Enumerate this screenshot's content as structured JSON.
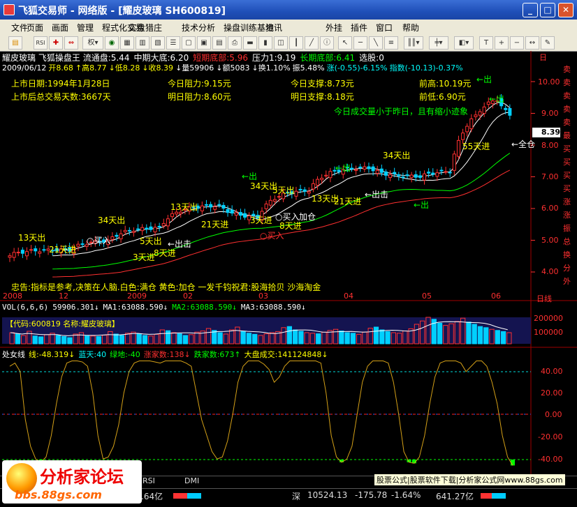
{
  "window": {
    "title": "飞狐交易师 - 网络版 - [耀皮玻璃  SH600819]",
    "controls": [
      "_",
      "□",
      "✕"
    ]
  },
  "menu": [
    "文件",
    "页面",
    "画面",
    "管理",
    "程式化交易",
    "实盘猎庄",
    "技术分析",
    "操盘训练基地",
    "资讯",
    "外挂",
    "插件",
    "窗口",
    "帮助"
  ],
  "toolbar": {
    "quanlabel": "权",
    "items": [
      "open-icon",
      "rsi-icon",
      "cross-icon",
      "arrows-icon",
      "weight-dropdown",
      "chart-icon",
      "grid-icon",
      "bars-icon",
      "period-icon",
      "zoom-icon"
    ]
  },
  "stock": {
    "name": "耀皮玻璃",
    "system": "飞狐操盘王",
    "line1": [
      {
        "t": "流通盘:5.44",
        "c": "#ffffff"
      },
      {
        "t": "中期大底:6.20",
        "c": "#ffffff"
      },
      {
        "t": "短期底部:5.96",
        "c": "#ff3030"
      },
      {
        "t": "压力1:9.19",
        "c": "#ffffff"
      },
      {
        "t": "长期底部:6.41",
        "c": "#00ff00"
      },
      {
        "t": "选股:0",
        "c": "#ffffff"
      }
    ],
    "line2": [
      {
        "t": "2009/06/12",
        "c": "#ffffff"
      },
      {
        "t": "开8.68",
        "c": "#ffff00"
      },
      {
        "t": "↑高8.77",
        "c": "#ffff00"
      },
      {
        "t": "↓低8.28",
        "c": "#ffff00"
      },
      {
        "t": "↓收8.39",
        "c": "#ffff00"
      },
      {
        "t": "↓量59906",
        "c": "#ffffff"
      },
      {
        "t": "↓额5083",
        "c": "#ffffff"
      },
      {
        "t": "↓换1.10%",
        "c": "#ffffff"
      },
      {
        "t": "振5.48%",
        "c": "#ffffff"
      },
      {
        "t": "涨(-0.55)-6.15%",
        "c": "#00ffff"
      },
      {
        "t": "指数(-10.13)-0.37%",
        "c": "#00ffff"
      }
    ]
  },
  "info": {
    "list_date_label": "上市日期:",
    "list_date": "1994年1月28日",
    "days_label": "上市后总交易天数:",
    "days": "3667天",
    "res_today": "今日阻力:9.15元",
    "res_tomorrow": "明日阻力:8.60元",
    "sup_today": "今日支撑:8.73元",
    "sup_tomorrow": "明日支撑:8.18元",
    "prev_high": "前高:10.19元",
    "prev_low": "前低:6.90元",
    "volume_note": "今日成交量小于昨日，且有缩小迹象",
    "footer": "忠告:指标是参考,决策在人脑.白色:满仓   黄色:加仓   一发千钧祝君:股海拾贝 沙海淘金"
  },
  "annotations": [
    {
      "t": "13天出",
      "c": "#ffff00"
    },
    {
      "t": "21天进",
      "c": "#ffff00"
    },
    {
      "t": "34天出",
      "c": "#ffff00"
    },
    {
      "t": "○买入",
      "c": "#ffffff"
    },
    {
      "t": "5天出",
      "c": "#ffff00"
    },
    {
      "t": "←出击",
      "c": "#ffffff"
    },
    {
      "t": "3天进",
      "c": "#ffff00"
    },
    {
      "t": "8天进",
      "c": "#ffff00"
    },
    {
      "t": "13天出",
      "c": "#ffff00"
    },
    {
      "t": "21天进",
      "c": "#ffff00"
    },
    {
      "t": "←出",
      "c": "#00ff00"
    },
    {
      "t": "34天出",
      "c": "#ffff00"
    },
    {
      "t": "5天出",
      "c": "#ffff00"
    },
    {
      "t": "3天进",
      "c": "#ffff00"
    },
    {
      "t": "○买入",
      "c": "#ffffff"
    },
    {
      "t": "加仓",
      "c": "#ffffff"
    },
    {
      "t": "8天进",
      "c": "#ffff00"
    },
    {
      "t": "○买入",
      "c": "#ff3030"
    },
    {
      "t": "13天出",
      "c": "#ffff00"
    },
    {
      "t": "21天进",
      "c": "#ffff00"
    },
    {
      "t": "←出",
      "c": "#00ff00"
    },
    {
      "t": "←出击",
      "c": "#ffffff"
    },
    {
      "t": "34天出",
      "c": "#ffff00"
    },
    {
      "t": "←出",
      "c": "#00ff00"
    },
    {
      "t": "55天进",
      "c": "#ffff00"
    },
    {
      "t": "←全仓",
      "c": "#ffffff"
    },
    {
      "t": "←出",
      "c": "#00ff00"
    },
    {
      "t": "←出",
      "c": "#00ff00"
    }
  ],
  "price_axis": {
    "ticks": [
      "10.00",
      "9.00",
      "8.00",
      "7.00",
      "6.00",
      "5.00",
      "4.00"
    ],
    "current": "8.39",
    "right_tabs": [
      "卖",
      "卖",
      "卖",
      "卖",
      "卖",
      "最",
      "买",
      "买",
      "买",
      "买",
      "涨",
      "涨",
      "振",
      "总",
      "换",
      "分",
      "外"
    ],
    "top_tab": "日"
  },
  "date_axis": {
    "labels": [
      "2008",
      "12",
      "2009",
      "02",
      "03",
      "04",
      "05",
      "06"
    ],
    "period": "日线"
  },
  "volume": {
    "header": [
      {
        "t": "VOL(6,6,6)",
        "c": "#ffffff"
      },
      {
        "t": "59906.301↓",
        "c": "#ffffff"
      },
      {
        "t": "MA1:63088.590↓",
        "c": "#ffffff"
      },
      {
        "t": "MA2:63088.590↓",
        "c": "#00ff00"
      },
      {
        "t": "MA3:63088.590↓",
        "c": "#ffffff"
      }
    ],
    "code_bar": "【代码:600819  名称:耀皮玻璃】",
    "ticks": [
      "200000",
      "100000"
    ],
    "bars": [
      40,
      35,
      30,
      45,
      28,
      25,
      33,
      38,
      30,
      26,
      22,
      35,
      40,
      30,
      28,
      26,
      31,
      44,
      35,
      30,
      38,
      42,
      36,
      30,
      28,
      34,
      50,
      47,
      40,
      36,
      30,
      33,
      42,
      46,
      55,
      48,
      40,
      35,
      50,
      60,
      45,
      38,
      34,
      30,
      36,
      40,
      44,
      58,
      62,
      50,
      45,
      40,
      38,
      36,
      42,
      48,
      52,
      46,
      40,
      38,
      34,
      42,
      56,
      60,
      50,
      44,
      40,
      38,
      46,
      54,
      70,
      82,
      95,
      88,
      74,
      66,
      72,
      80,
      92,
      78,
      70,
      62,
      58,
      52,
      48,
      44,
      40
    ],
    "red": [
      1,
      0,
      1,
      1,
      0,
      0,
      1,
      1,
      0,
      0,
      0,
      1,
      1,
      0,
      1,
      0,
      1,
      1,
      0,
      0,
      1,
      1,
      0,
      0,
      1,
      1,
      1,
      0,
      1,
      0,
      0,
      1,
      1,
      1,
      1,
      0,
      0,
      1,
      1,
      1,
      0,
      0,
      0,
      1,
      1,
      1,
      1,
      1,
      0,
      0,
      0,
      1,
      1,
      0,
      1,
      1,
      1,
      0,
      0,
      0,
      1,
      1,
      1,
      0,
      0,
      0,
      1,
      1,
      1,
      1,
      1,
      1,
      1,
      0,
      0,
      1,
      1,
      1,
      1,
      0,
      0,
      0,
      0,
      1,
      0,
      0,
      1
    ]
  },
  "indicator": {
    "header": [
      {
        "t": "处女线",
        "c": "#ffffff"
      },
      {
        "t": "线:-48.319↓",
        "c": "#ffff00"
      },
      {
        "t": "蓝天:40",
        "c": "#00ffff"
      },
      {
        "t": "绿地:-40",
        "c": "#00ff00"
      },
      {
        "t": "涨家数:138↓",
        "c": "#ff3030"
      },
      {
        "t": "跌家数:673↑",
        "c": "#00ff00"
      },
      {
        "t": "大盘成交:141124848↓",
        "c": "#ffff00"
      }
    ],
    "ticks": [
      "40.00",
      "20.00",
      "0.00",
      "-20.00",
      "-40.00"
    ],
    "line": [
      45,
      48,
      40,
      -5,
      -30,
      -42,
      -45,
      -40,
      -20,
      10,
      35,
      48,
      50,
      50,
      49,
      45,
      20,
      -20,
      -42,
      -40,
      -30,
      -10,
      20,
      40,
      48,
      50,
      50,
      50,
      49,
      48,
      50,
      50,
      50,
      50,
      48,
      45,
      20,
      -5,
      -20,
      -35,
      -42,
      -40,
      -25,
      0,
      30,
      45,
      50,
      50,
      50,
      47,
      42,
      30,
      35,
      45,
      50,
      50,
      50,
      50,
      50,
      50,
      48,
      20,
      -20,
      -40,
      -45,
      -42,
      -30,
      0,
      30,
      45,
      50,
      50,
      50,
      48,
      30,
      0,
      -35,
      -45,
      -46,
      -40,
      -20,
      10,
      35,
      48,
      50,
      50,
      50,
      48,
      40,
      45,
      50,
      50,
      45,
      30,
      10,
      -20,
      -40,
      -48
    ]
  },
  "bottom_tabs": [
    "RSI",
    "DMI"
  ],
  "status_bar": {
    "prefix": ".64亿",
    "exchange": "深",
    "index": "10524.13",
    "change": "-175.78",
    "pct": "-1.64%",
    "amount": "641.27亿"
  },
  "watermark": {
    "title": "分析家论坛",
    "url": "bbs.88gs.com",
    "promo": "股票公式|股票软件下载|分析家公式网www.88gs.com"
  }
}
